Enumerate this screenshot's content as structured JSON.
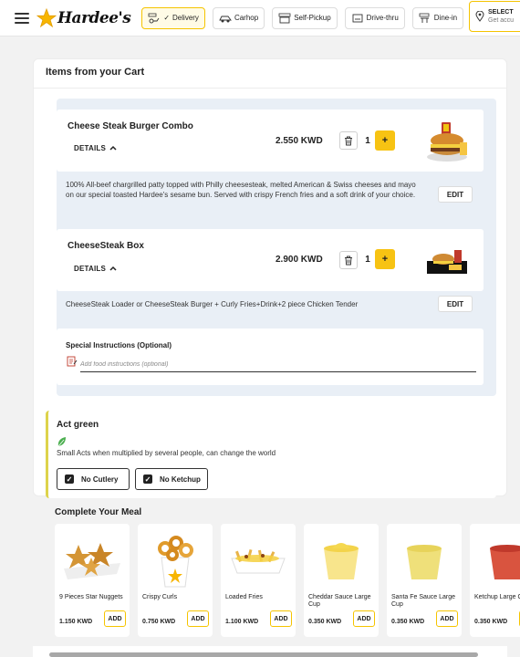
{
  "header": {
    "logo_text": "Hardee's",
    "modes": [
      {
        "label": "Delivery",
        "active": true,
        "icon": "delivery-scooter-icon"
      },
      {
        "label": "Carhop",
        "active": false,
        "icon": "car-icon"
      },
      {
        "label": "Self-Pickup",
        "active": false,
        "icon": "store-pickup-icon"
      },
      {
        "label": "Drive-thru",
        "active": false,
        "icon": "drive-thru-icon"
      },
      {
        "label": "Dine-in",
        "active": false,
        "icon": "dine-in-icon"
      }
    ],
    "location_title": "SELECT",
    "location_sub": "Get accu"
  },
  "cart": {
    "title": "Items from your Cart",
    "items": [
      {
        "name": "Cheese Steak Burger Combo",
        "details_label": "DETAILS",
        "price": "2.550 KWD",
        "quantity": "1",
        "description": "100% All-beef chargrilled patty topped with Philly cheesesteak, melted American & Swiss cheeses and mayo on our special toasted Hardee's sesame bun. Served with crispy French fries and a soft drink of your choice.",
        "edit_label": "EDIT"
      },
      {
        "name": "CheeseSteak Box",
        "details_label": "DETAILS",
        "price": "2.900 KWD",
        "quantity": "1",
        "description": "CheeseSteak Loader or CheeseSteak Burger + Curly Fries+Drink+2 piece Chicken Tender",
        "edit_label": "EDIT"
      }
    ],
    "plus_label": "+",
    "special": {
      "label": "Special Instructions (Optional)",
      "placeholder": "Add food instructions (optional)"
    }
  },
  "act_green": {
    "title": "Act green",
    "text": "Small Acts when multiplied by several people, can change the world",
    "options": [
      {
        "label": "No Cutlery",
        "checked": true
      },
      {
        "label": "No Ketchup",
        "checked": true
      }
    ]
  },
  "meal": {
    "title": "Complete Your Meal",
    "add_label": "ADD",
    "items": [
      {
        "name": "9 Pieces Star Nuggets",
        "price": "1.150 KWD"
      },
      {
        "name": "Crispy Curls",
        "price": "0.750 KWD"
      },
      {
        "name": "Loaded Fries",
        "price": "1.100 KWD"
      },
      {
        "name": "Cheddar Sauce Large Cup",
        "price": "0.350 KWD"
      },
      {
        "name": "Santa Fe Sauce Large Cup",
        "price": "0.350 KWD"
      },
      {
        "name": "Ketchup Large Cup",
        "price": "0.350 KWD"
      }
    ]
  },
  "colors": {
    "accent": "#f7c313",
    "panel": "#e9eff6",
    "green_bar": "#ddd34b"
  }
}
